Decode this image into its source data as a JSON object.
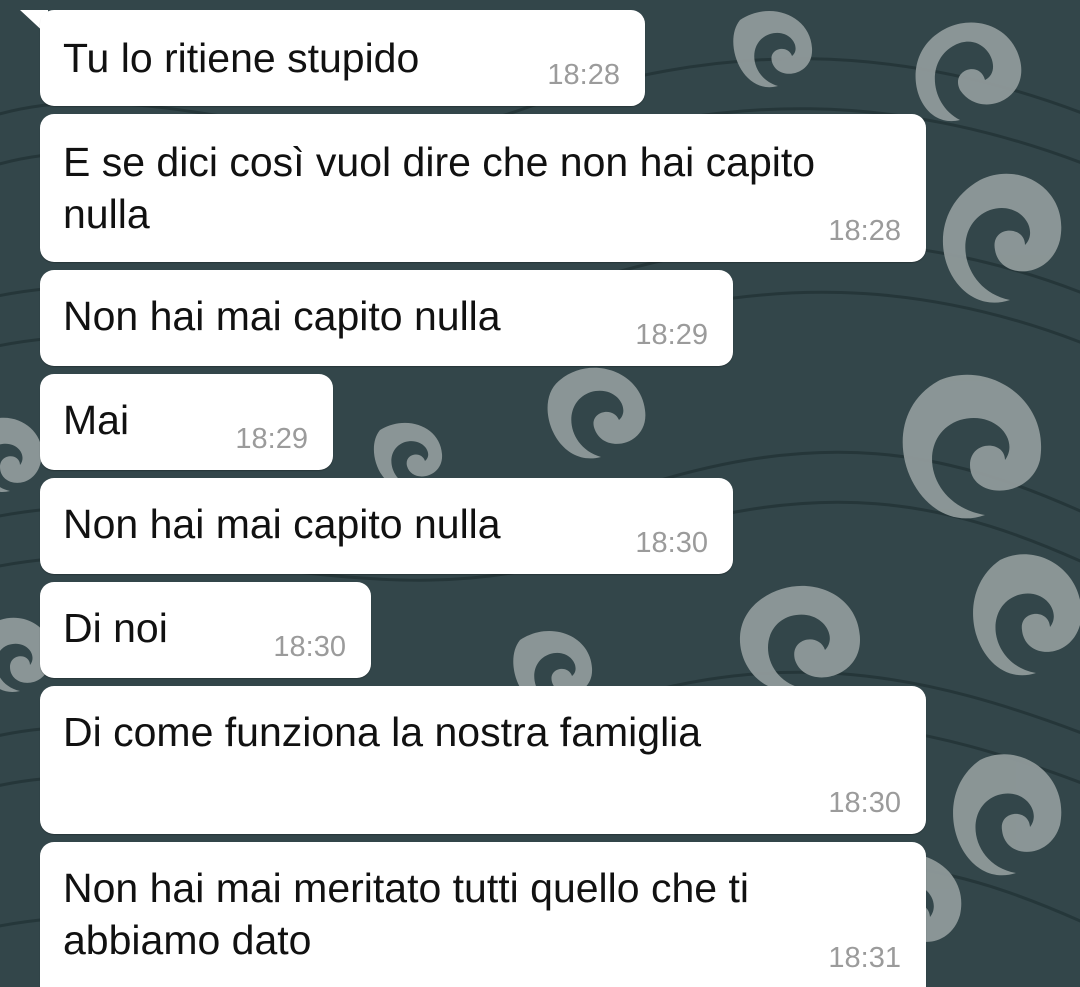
{
  "colors": {
    "wallpaper_dark": "#33464a",
    "wallpaper_wave": "#8f9a9a",
    "bubble": "#ffffff",
    "message_text": "#111111",
    "timestamp": "#9b9b9b"
  },
  "messages": [
    {
      "text": "Tu lo ritiene stupido",
      "time": "18:28"
    },
    {
      "text": "E se dici così vuol dire che non hai capito\nnulla",
      "time": "18:28"
    },
    {
      "text": "Non hai mai capito nulla",
      "time": "18:29"
    },
    {
      "text": "Mai",
      "time": "18:29"
    },
    {
      "text": "Non hai mai capito nulla",
      "time": "18:30"
    },
    {
      "text": "Di noi",
      "time": "18:30"
    },
    {
      "text": "Di come funziona la nostra famiglia",
      "time": "18:30"
    },
    {
      "text": "Non hai mai meritato tutti quello che ti\nabbiamo dato",
      "time": "18:31"
    }
  ]
}
